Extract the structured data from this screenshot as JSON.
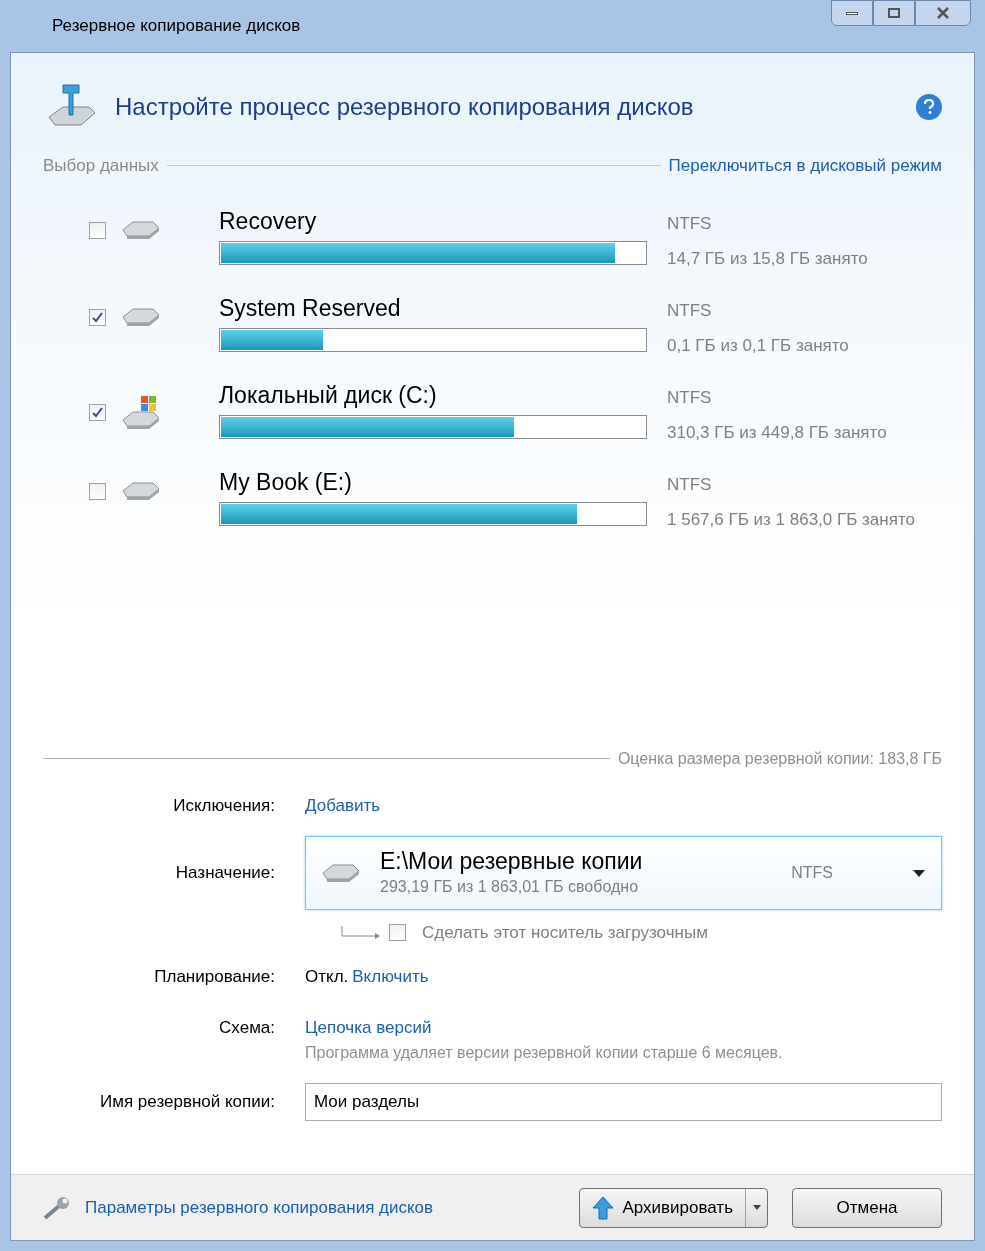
{
  "window": {
    "title": "Резервное копирование дисков"
  },
  "header": {
    "title": "Настройте процесс резервного копирования дисков"
  },
  "data_selection": {
    "label": "Выбор данных",
    "switch_link": "Переключиться в дисковый режим"
  },
  "volumes": [
    {
      "name": "Recovery",
      "checked": false,
      "kind": "drive",
      "level": 0.93,
      "fs": "NTFS",
      "usage": "14,7 ГБ из 15,8 ГБ занято"
    },
    {
      "name": "System Reserved",
      "checked": true,
      "kind": "drive",
      "level": 0.24,
      "fs": "NTFS",
      "usage": "0,1 ГБ из 0,1 ГБ занято"
    },
    {
      "name": "Локальный диск (C:)",
      "checked": true,
      "kind": "system",
      "level": 0.69,
      "fs": "NTFS",
      "usage": "310,3 ГБ из 449,8 ГБ занято"
    },
    {
      "name": "My Book (E:)",
      "checked": false,
      "kind": "drive",
      "level": 0.84,
      "fs": "NTFS",
      "usage": "1 567,6 ГБ из 1 863,0 ГБ занято"
    }
  ],
  "estimate": "Оценка размера резервной копии: 183,8 ГБ",
  "exclusions": {
    "label": "Исключения:",
    "link": "Добавить"
  },
  "destination": {
    "label": "Назначение:",
    "path": "E:\\Мои резервные копии",
    "free": "293,19 ГБ из 1 863,01 ГБ свободно",
    "fs": "NTFS"
  },
  "bootable": {
    "label": "Сделать этот носитель загрузочным",
    "checked": false
  },
  "schedule": {
    "label": "Планирование:",
    "value": "Откл.",
    "link": "Включить"
  },
  "scheme": {
    "label": "Схема:",
    "link": "Цепочка версий",
    "description": "Программа удаляет версии резервной копии старше 6 месяцев."
  },
  "backup_name": {
    "label": "Имя резервной копии:",
    "value": "Мои разделы"
  },
  "footer": {
    "options_link": "Параметры резервного копирования дисков",
    "primary": "Архивировать",
    "cancel": "Отмена"
  }
}
